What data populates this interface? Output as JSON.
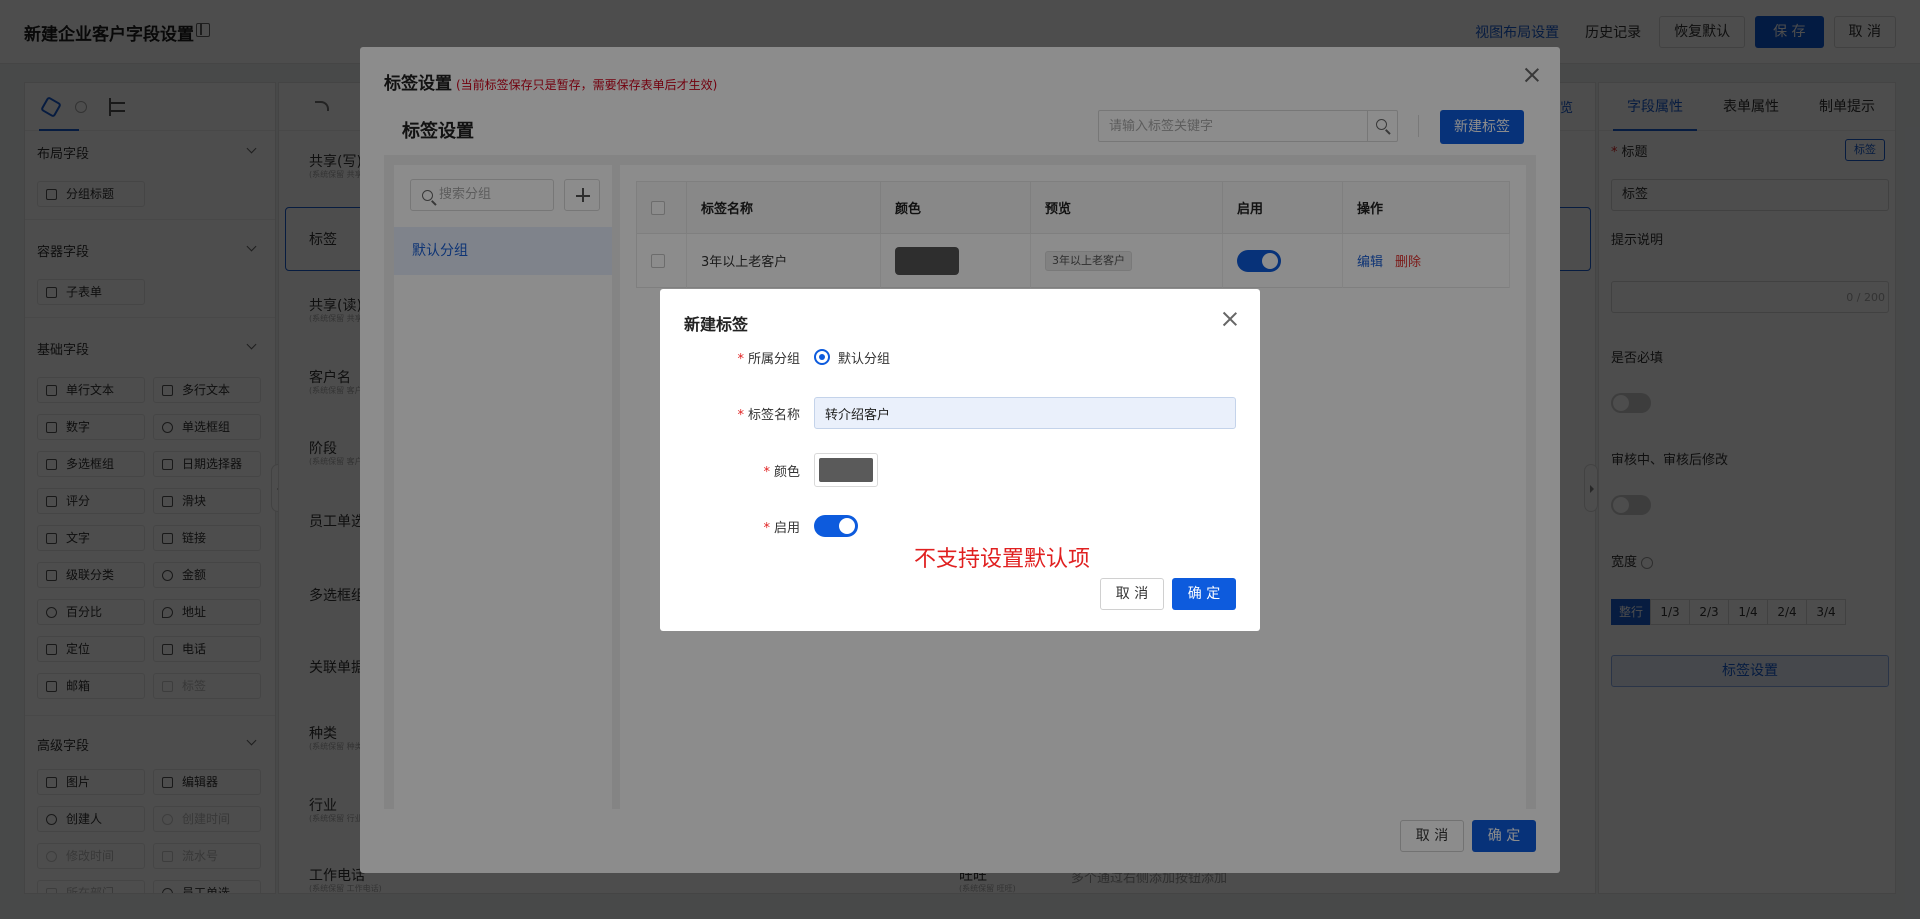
{
  "page": {
    "title": "新建企业客户字段设置",
    "actions": {
      "view_layout": "视图布局设置",
      "history": "历史记录",
      "restore_default": "恢复默认",
      "save": "保 存",
      "cancel": "取 消"
    }
  },
  "left_panel": {
    "groups": [
      {
        "title": "布局字段",
        "items": [
          {
            "label": "分组标题"
          }
        ]
      },
      {
        "title": "容器字段",
        "items": [
          {
            "label": "子表单"
          }
        ]
      },
      {
        "title": "基础字段",
        "items": [
          {
            "label": "单行文本"
          },
          {
            "label": "多行文本"
          },
          {
            "label": "数字"
          },
          {
            "label": "单选框组"
          },
          {
            "label": "多选框组"
          },
          {
            "label": "日期选择器"
          },
          {
            "label": "评分"
          },
          {
            "label": "滑块"
          },
          {
            "label": "文字"
          },
          {
            "label": "链接"
          },
          {
            "label": "级联分类"
          },
          {
            "label": "金额"
          },
          {
            "label": "百分比"
          },
          {
            "label": "地址"
          },
          {
            "label": "定位"
          },
          {
            "label": "电话"
          },
          {
            "label": "邮箱"
          },
          {
            "label": "标签"
          }
        ]
      },
      {
        "title": "高级字段",
        "items": [
          {
            "label": "图片"
          },
          {
            "label": "编辑器"
          },
          {
            "label": "创建人"
          },
          {
            "label": "创建时间"
          },
          {
            "label": "修改时间"
          },
          {
            "label": "流水号"
          },
          {
            "label": "所在部门"
          },
          {
            "label": "员工单选"
          }
        ]
      }
    ]
  },
  "canvas": {
    "preview": "预览",
    "fields": [
      {
        "label": "共享(写)",
        "sub": "(系统保留 共享)"
      },
      {
        "label": "标签",
        "sub": ""
      },
      {
        "label": "共享(读)",
        "sub": "(系统保留 共享)"
      },
      {
        "label": "客户名",
        "sub": "(系统保留 客户)"
      },
      {
        "label": "阶段",
        "sub": "(系统保留 客户)"
      },
      {
        "label": "员工单选",
        "sub": ""
      },
      {
        "label": "多选框组",
        "sub": ""
      },
      {
        "label": "关联单据",
        "sub": ""
      },
      {
        "label": "种类",
        "sub": "(系统保留 种类)"
      },
      {
        "label": "行业",
        "sub": "(系统保留 行业)"
      },
      {
        "label": "工作电话",
        "sub": "(系统保留 工作电话)"
      }
    ],
    "bottom_field": "旺旺",
    "bottom_sub": "(系统保留 旺旺)",
    "bottom_hint": "多个通过右侧添加按钮添加"
  },
  "right_panel": {
    "tabs": [
      "字段属性",
      "表单属性",
      "制单提示"
    ],
    "title_label": "标题",
    "title_tag": "标签",
    "title_value": "标签",
    "hint_label": "提示说明",
    "hint_counter": "0 / 200",
    "required_label": "是否必填",
    "audit_label": "审核中、审核后修改",
    "width_label": "宽度",
    "widths": [
      "整行",
      "1/3",
      "2/3",
      "1/4",
      "2/4",
      "3/4"
    ],
    "tag_settings_button": "标签设置"
  },
  "tag_modal": {
    "title": "标签设置",
    "warning": "(当前标签保存只是暂存，需要保存表单后才生效)",
    "subtitle": "标签设置",
    "search_placeholder": "请输入标签关键字",
    "new_button": "新建标签",
    "group_search_placeholder": "搜索分组",
    "groups": [
      "默认分组"
    ],
    "table": {
      "headers": [
        "标签名称",
        "颜色",
        "预览",
        "启用",
        "操作"
      ],
      "rows": [
        {
          "name": "3年以上老客户",
          "color": "#555555",
          "preview": "3年以上老客户",
          "enabled": true,
          "edit": "编辑",
          "delete": "删除"
        }
      ]
    },
    "cancel": "取 消",
    "ok": "确 定"
  },
  "new_tag_modal": {
    "title": "新建标签",
    "group_label": "所属分组",
    "group_value": "默认分组",
    "name_label": "标签名称",
    "name_value": "转介绍客户",
    "color_label": "颜色",
    "color_value": "#5a5a5a",
    "enable_label": "启用",
    "enabled": true,
    "annotation": "不支持设置默认项",
    "cancel": "取 消",
    "ok": "确 定"
  },
  "colors": {
    "primary": "#0d5bdd",
    "danger": "#e02020"
  }
}
